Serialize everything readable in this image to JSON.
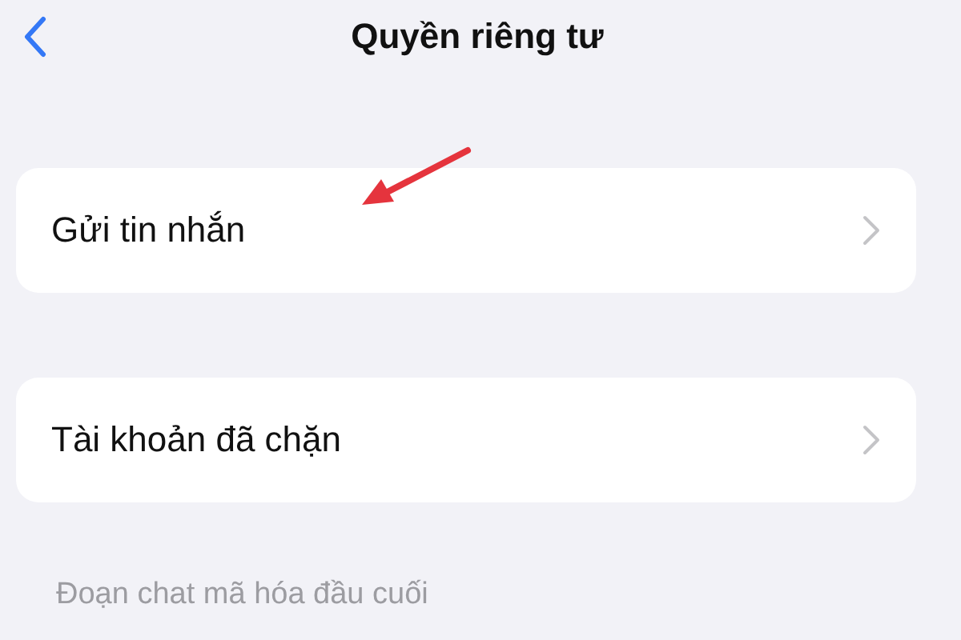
{
  "header": {
    "title": "Quyền riêng tư"
  },
  "items": [
    {
      "label": "Gửi tin nhắn"
    },
    {
      "label": "Tài khoản đã chặn"
    }
  ],
  "section_header": "Đoạn chat mã hóa đầu cuối"
}
